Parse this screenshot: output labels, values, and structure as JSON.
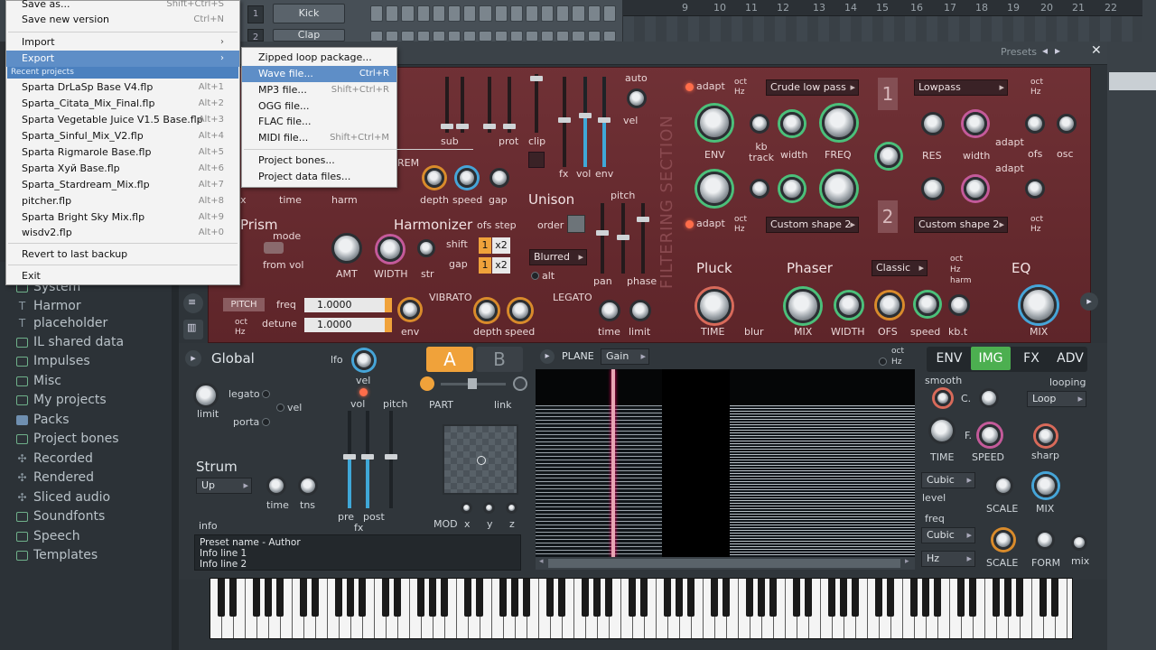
{
  "file_menu": {
    "top_items": [
      {
        "label": "Save as...",
        "shortcut": "Shift+Ctrl+S"
      },
      {
        "label": "Save new version",
        "shortcut": "Ctrl+N"
      }
    ],
    "import_label": "Import",
    "export_label": "Export",
    "recent_header": "Recent projects",
    "recent": [
      {
        "label": "Sparta DrLaSp Base V4.flp",
        "shortcut": "Alt+1"
      },
      {
        "label": "Sparta_Citata_Mix_Final.flp",
        "shortcut": "Alt+2"
      },
      {
        "label": "Sparta Vegetable Juice V1.5 Base.flp",
        "shortcut": "Alt+3"
      },
      {
        "label": "Sparta_Sinful_Mix_V2.flp",
        "shortcut": "Alt+4"
      },
      {
        "label": "Sparta Rigmarole Base.flp",
        "shortcut": "Alt+5"
      },
      {
        "label": "Sparta Хуй Base.flp",
        "shortcut": "Alt+6"
      },
      {
        "label": "Sparta_Stardream_Mix.flp",
        "shortcut": "Alt+7"
      },
      {
        "label": "pitcher.flp",
        "shortcut": "Alt+8"
      },
      {
        "label": "Sparta Bright Sky Mix.flp",
        "shortcut": "Alt+9"
      },
      {
        "label": "wisdv2.flp",
        "shortcut": "Alt+0"
      }
    ],
    "revert_label": "Revert to last backup",
    "exit_label": "Exit"
  },
  "export_submenu": [
    {
      "label": "Zipped loop package...",
      "shortcut": ""
    },
    {
      "label": "Wave file...",
      "shortcut": "Ctrl+R"
    },
    {
      "label": "MP3 file...",
      "shortcut": "Shift+Ctrl+R"
    },
    {
      "label": "OGG file...",
      "shortcut": ""
    },
    {
      "label": "FLAC file...",
      "shortcut": ""
    },
    {
      "label": "MIDI file...",
      "shortcut": "Shift+Ctrl+M"
    },
    {
      "label": "Project bones...",
      "shortcut": ""
    },
    {
      "label": "Project data files...",
      "shortcut": ""
    }
  ],
  "channel_rack": {
    "rows": [
      {
        "num": "1",
        "name": "Kick"
      },
      {
        "num": "2",
        "name": "Clap"
      }
    ]
  },
  "ruler": [
    "9",
    "10",
    "11",
    "12",
    "13",
    "14",
    "15",
    "16",
    "17",
    "18",
    "19",
    "20",
    "21",
    "22"
  ],
  "browser": {
    "items": [
      {
        "label": "System",
        "icon": "folder-icon"
      },
      {
        "label": "Harmor",
        "icon": "text-icon"
      },
      {
        "label": "placeholder",
        "icon": "text-icon"
      },
      {
        "label": "IL shared data",
        "icon": "folder-icon"
      },
      {
        "label": "Impulses",
        "icon": "folder-icon"
      },
      {
        "label": "Misc",
        "icon": "folder-icon"
      },
      {
        "label": "My projects",
        "icon": "folder-icon"
      },
      {
        "label": "Packs",
        "icon": "packs-icon"
      },
      {
        "label": "Project bones",
        "icon": "folder-icon"
      },
      {
        "label": "Recorded",
        "icon": "recorded-icon"
      },
      {
        "label": "Rendered",
        "icon": "rendered-icon"
      },
      {
        "label": "Sliced audio",
        "icon": "sliced-icon"
      },
      {
        "label": "Soundfonts",
        "icon": "folder-icon"
      },
      {
        "label": "Speech",
        "icon": "folder-icon"
      },
      {
        "label": "Templates",
        "icon": "folder-icon"
      }
    ]
  },
  "plugin": {
    "presets_label": "Presets",
    "top": {
      "auto": "auto",
      "vel": "vel",
      "sub": "sub",
      "prot": "prot",
      "clip": "clip",
      "fx": "fx",
      "vol": "vol",
      "env": "env",
      "rem": "REM",
      "x": "x",
      "time": "time",
      "harm": "harm",
      "depth": "depth",
      "speed": "speed",
      "gap": "gap",
      "unison": "Unison",
      "order": "order",
      "pitch": "pitch",
      "blurred": "Blurred",
      "alt": "alt",
      "pan": "pan",
      "phase": "phase",
      "prism": "Prism",
      "mode": "mode",
      "from_vol": "from vol",
      "amt": "AMT",
      "width": "WIDTH",
      "str": "str",
      "harmonizer": "Harmonizer",
      "ofs_step": "ofs step",
      "shift": "shift",
      "gap2": "gap",
      "x2a": "x2",
      "x2b": "x2",
      "one_a": "1",
      "one_b": "1",
      "vibrato": "VIBRATO",
      "legato": "LEGATO",
      "depth2": "depth",
      "speed2": "speed",
      "time2": "time",
      "limit": "limit",
      "pitch_btn": "PITCH",
      "freq": "freq",
      "detune": "detune",
      "freq_val": "1.0000",
      "detune_val": "1.0000",
      "oct": "oct",
      "hz": "Hz",
      "env2": "env",
      "filtering_section": "FILTERING SECTION"
    },
    "filter": {
      "adapt": "adapt",
      "oct": "oct",
      "hz": "Hz",
      "sel1": "Crude low pass",
      "sel2": "Lowpass",
      "sel3": "Custom shape 2",
      "sel4": "Custom shape 2",
      "env": "ENV",
      "kb_track": "kb\ntrack",
      "width": "width",
      "freq": "FREQ",
      "res": "RES",
      "width2": "width",
      "adapt2": "adapt",
      "ofs": "ofs",
      "osc": "osc",
      "adapt3": "adapt",
      "f1": "1",
      "f2": "2",
      "pluck": "Pluck",
      "phaser": "Phaser",
      "classic": "Classic",
      "eq": "EQ",
      "time": "TIME",
      "blur": "blur",
      "mix": "MIX",
      "width3": "WIDTH",
      "ofs2": "OFS",
      "speed": "speed",
      "kbt": "kb.t",
      "mix2": "MIX",
      "oct2": "oct",
      "hz2": "Hz",
      "harm": "harm"
    },
    "lower": {
      "global": "Global",
      "lfo": "lfo",
      "legato": "legato",
      "vel": "vel",
      "porta": "porta",
      "limit": "limit",
      "vel2": "vel",
      "vol": "vol",
      "pitch": "pitch",
      "strum": "Strum",
      "strum_sel": "Up",
      "time": "time",
      "tns": "tns",
      "pre": "pre",
      "post": "post",
      "fx": "fx",
      "info": "info",
      "info_lines": [
        "Preset name - Author",
        "Info line 1",
        "Info line 2"
      ],
      "tab_a": "A",
      "tab_b": "B",
      "part": "PART",
      "link": "link",
      "mod": "MOD",
      "x": "x",
      "y": "y",
      "z": "z",
      "plane": "PLANE",
      "gain": "Gain",
      "oct": "oct",
      "hz": "Hz"
    },
    "right": {
      "tabs": [
        "ENV",
        "IMG",
        "FX",
        "ADV"
      ],
      "active_tab": "IMG",
      "smooth": "smooth",
      "c": "C.",
      "looping": "looping",
      "loop": "Loop",
      "f": "F.",
      "time": "TIME",
      "speed": "SPEED",
      "sharp": "sharp",
      "cubic1": "Cubic",
      "level": "level",
      "scale": "SCALE",
      "mix": "MIX",
      "freq": "freq",
      "cubic2": "Cubic",
      "scale2": "SCALE",
      "form": "FORM",
      "mix2": "mix",
      "hz": "Hz"
    }
  },
  "colors": {
    "panel_red": "#6b2a2f",
    "accent_green": "#4bc07a",
    "accent_orange": "#f0a23a",
    "menu_highlight": "#5e8ec7"
  }
}
